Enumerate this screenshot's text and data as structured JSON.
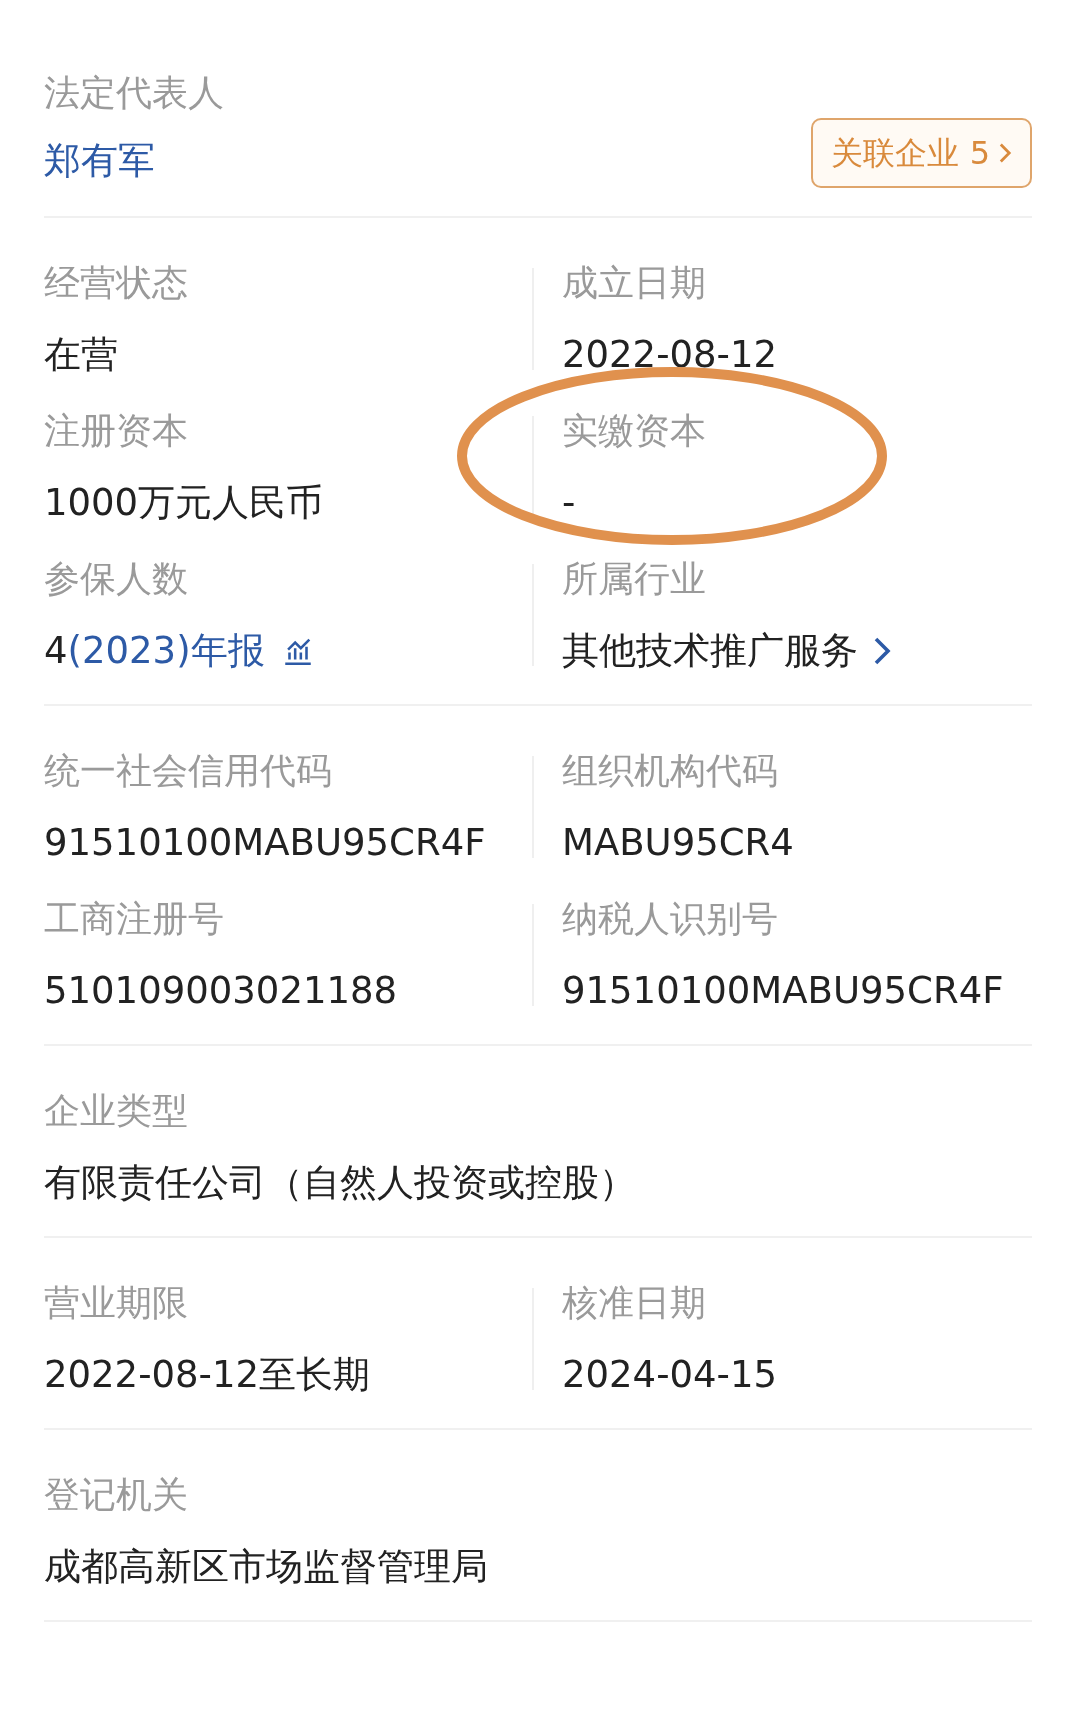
{
  "legal_rep": {
    "label": "法定代表人",
    "name": "郑有军",
    "related_button": "关联企业 5"
  },
  "sections": [
    {
      "rows": [
        [
          {
            "label": "经营状态",
            "value": "在营",
            "kind": "plain",
            "circled": false
          },
          {
            "label": "成立日期",
            "value": "2022-08-12",
            "kind": "plain",
            "circled": false
          }
        ],
        [
          {
            "label": "注册资本",
            "value": "1000万元人民币",
            "kind": "plain",
            "circled": false
          },
          {
            "label": "实缴资本",
            "value": "-",
            "kind": "plain",
            "circled": true
          }
        ],
        [
          {
            "label": "参保人数",
            "value": "4",
            "link": "(2023)年报",
            "kind": "report",
            "circled": false
          },
          {
            "label": "所属行业",
            "value": "其他技术推广服务",
            "kind": "category",
            "circled": false
          }
        ]
      ]
    },
    {
      "rows": [
        [
          {
            "label": "统一社会信用代码",
            "value": "91510100MABU95CR4F",
            "kind": "plain",
            "circled": false
          },
          {
            "label": "组织机构代码",
            "value": "MABU95CR4",
            "kind": "plain",
            "circled": false
          }
        ],
        [
          {
            "label": "工商注册号",
            "value": "510109003021188",
            "kind": "plain",
            "circled": false
          },
          {
            "label": "纳税人识别号",
            "value": "91510100MABU95CR4F",
            "kind": "plain",
            "circled": false
          }
        ]
      ]
    },
    {
      "rows": [
        [
          {
            "label": "企业类型",
            "value": "有限责任公司（自然人投资或控股）",
            "kind": "plain",
            "circled": false
          }
        ]
      ]
    },
    {
      "rows": [
        [
          {
            "label": "营业期限",
            "value": "2022-08-12至长期",
            "kind": "plain",
            "circled": false
          },
          {
            "label": "核准日期",
            "value": "2024-04-15",
            "kind": "plain",
            "circled": false
          }
        ]
      ]
    },
    {
      "rows": [
        [
          {
            "label": "登记机关",
            "value": "成都高新区市场监督管理局",
            "kind": "plain",
            "circled": false
          }
        ]
      ]
    }
  ]
}
